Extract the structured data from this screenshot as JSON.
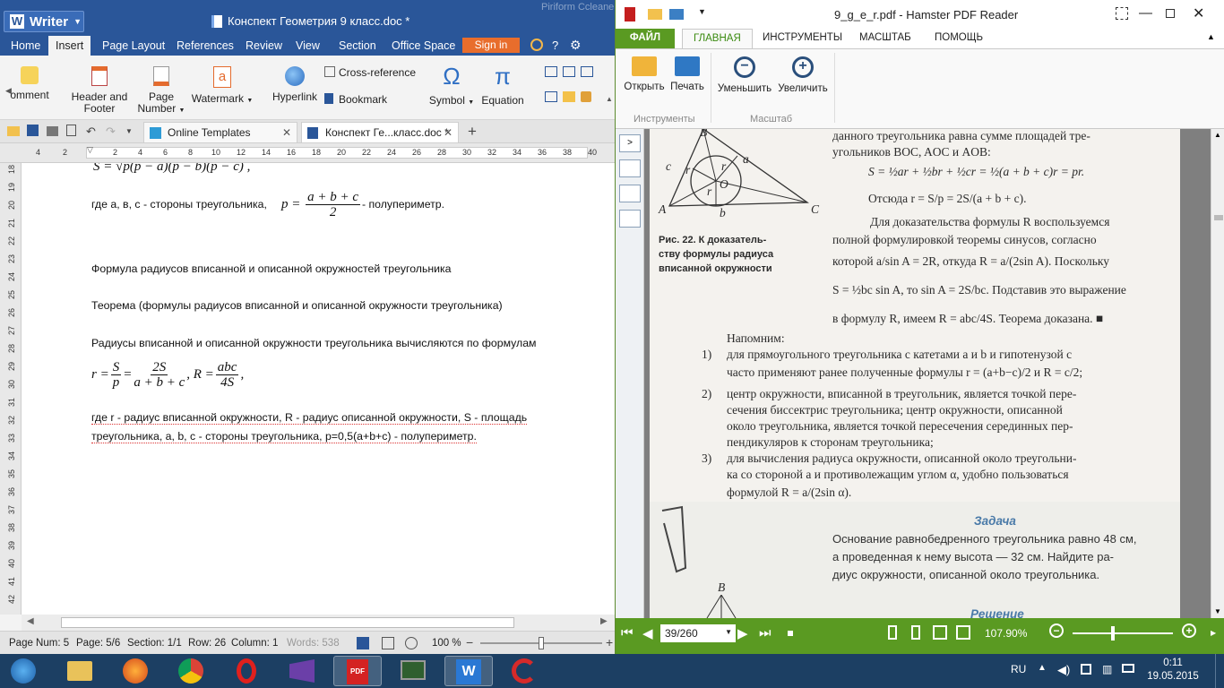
{
  "writer": {
    "app_name": "Writer",
    "doc_title": "Конспект Геометрия 9 класс.doc *",
    "ghost_title": "Piriform Ccleaner",
    "menu": [
      "Home",
      "Insert",
      "Page Layout",
      "References",
      "Review",
      "View",
      "Section",
      "Office Space"
    ],
    "sign_in": "Sign in",
    "ribbon": {
      "comment": "omment",
      "header_footer_1": "Header and",
      "header_footer_2": "Footer",
      "page_number_1": "Page",
      "page_number_2": "Number",
      "watermark": "Watermark",
      "hyperlink": "Hyperlink",
      "cross_reference": "Cross-reference",
      "bookmark": "Bookmark",
      "symbol": "Symbol",
      "equation": "Equation"
    },
    "tabs": [
      "Online Templates",
      "Конспект Ге...класс.doc *"
    ],
    "ruler_h": [
      "4",
      "2",
      "2",
      "4",
      "6",
      "8",
      "10",
      "12",
      "14",
      "16",
      "18",
      "20",
      "22",
      "24",
      "26",
      "28",
      "30",
      "32",
      "34",
      "36",
      "38",
      "40"
    ],
    "ruler_v": [
      "18",
      "19",
      "20",
      "21",
      "22",
      "23",
      "24",
      "25",
      "26",
      "27",
      "28",
      "29",
      "30",
      "31",
      "32",
      "33",
      "34",
      "35",
      "36",
      "37",
      "38",
      "39",
      "40",
      "41",
      "42"
    ],
    "doc": {
      "line_top_formula": "S = √p(p − a)(p − b)(p − c) ,",
      "line1_a": "где а, в, с - стороны треугольника,",
      "line1_f_lhs": "p =",
      "line1_f_num": "a + b + c",
      "line1_f_den": "2",
      "line1_b": "- полупериметр.",
      "heading": "Формула радиусов вписанной и описанной окружностей треугольника",
      "theorem": "Теорема (формулы радиусов вписанной и описанной окружности треугольника)",
      "radii": "Радиусы вписанной и описанной окружности треугольника вычисляются по формулам",
      "f_r": "r =",
      "f_S": "S",
      "f_p": "p",
      "f_eq": "=",
      "f_2S": "2S",
      "f_abc_den": "a + b + c",
      "f_R": ", R =",
      "f_abc": "abc",
      "f_4S": "4S",
      "f_comma": ",",
      "desc1": "где  r  -  радиус  вписанной  окружности,  R  -  радиус  описанной  окружности,  S  -  площадь",
      "desc2": "треугольника, a, b, c - стороны треугольника, p=0,5(a+b+c) - полупериметр."
    },
    "status": {
      "page_num": "Page Num: 5",
      "page": "Page: 5/6",
      "section": "Section: 1/1",
      "row": "Row: 26",
      "column": "Column: 1",
      "words": "Words: 538",
      "zoom": "100 %",
      "zoom_level": 0.5
    }
  },
  "pdf": {
    "title": "9_g_e_r.pdf - Hamster PDF Reader",
    "tabs": [
      "ФАЙЛ",
      "ГЛАВНАЯ",
      "ИНСТРУМЕНТЫ",
      "МАСШТАБ",
      "ПОМОЩЬ"
    ],
    "buttons": [
      "Открыть",
      "Печать",
      "Уменьшить",
      "Увеличить"
    ],
    "groups": [
      "Инструменты",
      "Масштаб"
    ],
    "page": {
      "fig_caption_1": "Рис. 22. К доказатель-",
      "fig_caption_2": "ству формулы радиуса",
      "fig_caption_3": "вписанной окружности",
      "fig_labels": [
        "A",
        "B",
        "C",
        "a",
        "b",
        "c",
        "O",
        "r",
        "r",
        "r"
      ],
      "p1": "данного треугольника равна сумме площадей тре-",
      "p2": "угольников BOC, AOC и AOB:",
      "p3": "S = ½ar + ½br + ½cr = ½(a + b + c)r = pr.",
      "p4": "Отсюда  r = S/p = 2S/(a + b + c).",
      "p5": "Для доказательства формулы R воспользуемся",
      "p6": "полной формулировкой теоремы синусов, согласно",
      "p7": "которой  a/sin A = 2R,  откуда  R = a/(2sin A).  Поскольку",
      "p8": "S = ½bc sin A, то sin A = 2S/bc. Подставив это выражение",
      "p9": "в формулу R, имеем  R = abc/4S.  Теорема доказана. ■",
      "remind": "Напомним:",
      "i1_num": "1)",
      "i1a": "для прямоугольного треугольника с катетами a и b и гипотенузой c",
      "i1b": "часто применяют ранее полученные формулы  r = (a+b−c)/2  и  R = c/2;",
      "i2_num": "2)",
      "i2a": "центр окружности, вписанной в треугольник, является точкой пере-",
      "i2b": "сечения биссектрис треугольника; центр окружности, описанной",
      "i2c": "около треугольника, является точкой пересечения серединных пер-",
      "i2d": "пендикуляров к сторонам треугольника;",
      "i3_num": "3)",
      "i3a": "для вычисления радиуса окружности, описанной около треугольни-",
      "i3b": "ка со стороной a и противолежащим углом α, удобно пользоваться",
      "i3c": "формулой  R = a/(2sin α).",
      "task_head": "Задача",
      "task1": "Основание равнобедренного треугольника равно 48 см,",
      "task2": "а проведенная к нему высота — 32 см. Найдите ра-",
      "task3": "диус окружности, описанной около треугольника.",
      "solution": "Решение",
      "solution_fig_label": "B"
    },
    "page_box": "39/260",
    "zoom": "107.90%",
    "zoom_level": 0.4
  },
  "taskbar": {
    "lang": "RU",
    "time": "0:11",
    "date": "19.05.2015"
  },
  "colors": {
    "writer_blue": "#2a5699",
    "signin_orange": "#e86d2c",
    "hamster_green": "#5a9a22",
    "taskbar": "#1c3f63"
  }
}
